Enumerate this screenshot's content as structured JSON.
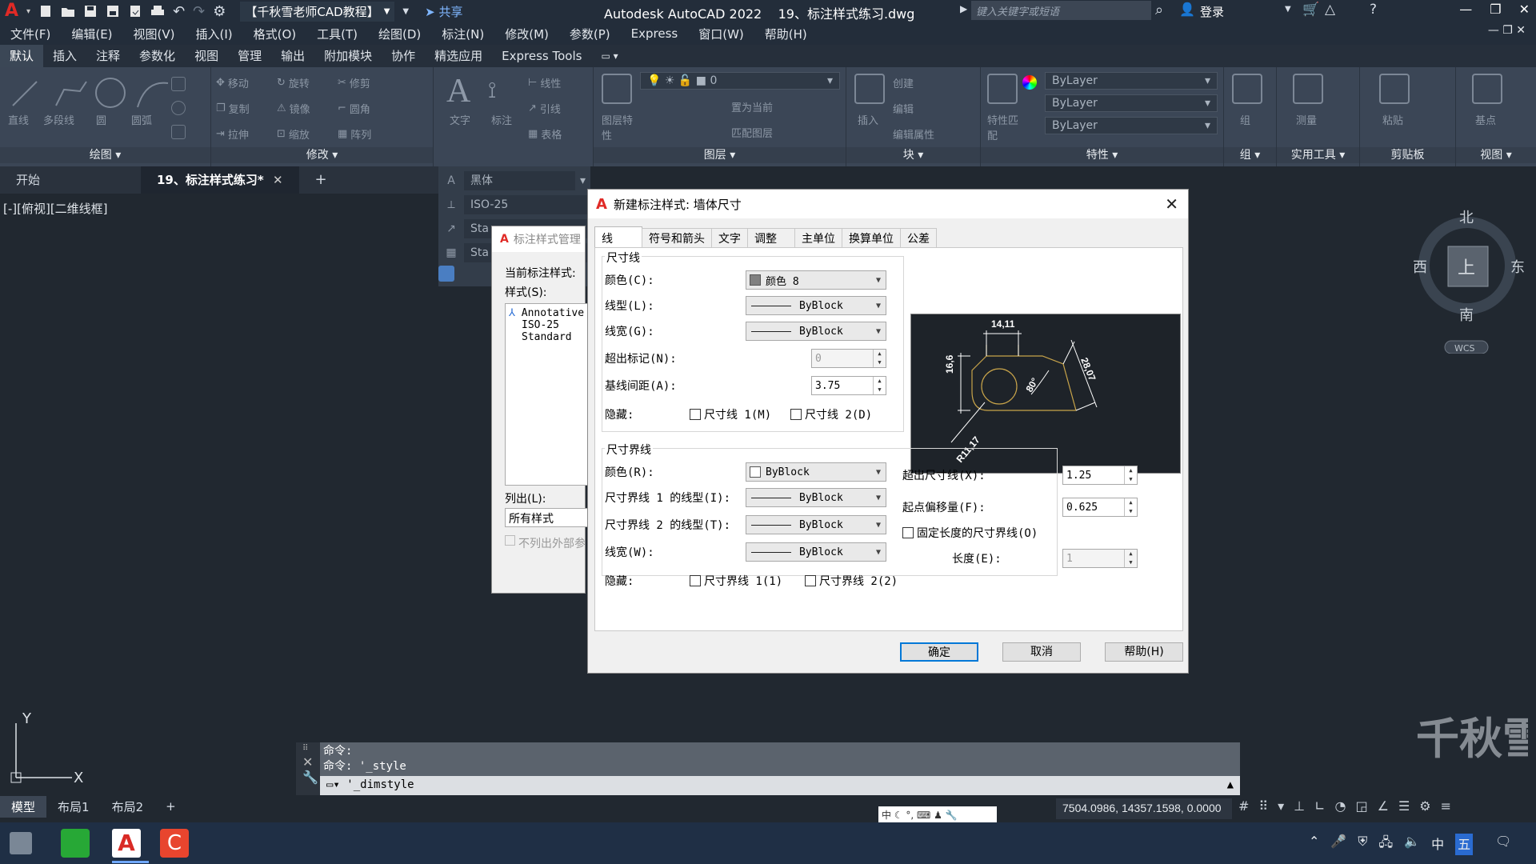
{
  "titlebar": {
    "workspace": "【千秋雪老师CAD教程】",
    "share": "共享",
    "app_title": "Autodesk AutoCAD 2022",
    "doc_title": "19、标注样式练习.dwg",
    "search_placeholder": "键入关键字或短语",
    "login": "登录"
  },
  "menubar": [
    "文件(F)",
    "编辑(E)",
    "视图(V)",
    "插入(I)",
    "格式(O)",
    "工具(T)",
    "绘图(D)",
    "标注(N)",
    "修改(M)",
    "参数(P)",
    "Express",
    "窗口(W)",
    "帮助(H)"
  ],
  "ribbon_tabs": [
    "默认",
    "插入",
    "注释",
    "参数化",
    "视图",
    "管理",
    "输出",
    "附加模块",
    "协作",
    "精选应用",
    "Express Tools"
  ],
  "ribbon": {
    "draw": {
      "label": "绘图",
      "btns": [
        "直线",
        "多段线",
        "圆",
        "圆弧"
      ]
    },
    "modify": {
      "label": "修改",
      "btns": [
        "移动",
        "旋转",
        "修剪",
        "复制",
        "镜像",
        "圆角",
        "拉伸",
        "缩放",
        "阵列"
      ]
    },
    "annotation": {
      "btns": [
        "文字",
        "标注",
        "线性",
        "引线",
        "表格"
      ]
    },
    "layers": {
      "label": "图层",
      "props": "图层特性",
      "layer_value": "0",
      "set_current": "置为当前",
      "match_layer": "匹配图层"
    },
    "block": {
      "label": "块",
      "insert": "插入",
      "create": "创建",
      "edit": "编辑",
      "edit_attr": "编辑属性"
    },
    "properties": {
      "label": "特性",
      "match": "特性匹配",
      "color": "ByLayer",
      "linetype": "ByLayer",
      "lineweight": "ByLayer"
    },
    "group": {
      "label": "组",
      "btn": "组"
    },
    "utilities": {
      "label": "实用工具",
      "btn": "测量"
    },
    "clipboard": {
      "label": "剪贴板",
      "btn": "粘贴"
    },
    "view": {
      "label": "视图",
      "btn": "基点"
    }
  },
  "doc_tabs": [
    "开始",
    "19、标注样式练习*"
  ],
  "viewport_label": "[-][俯视][二维线框]",
  "palette": {
    "font": "黑体",
    "dimstyle": "ISO-25",
    "r3": "Sta",
    "r4": "Sta"
  },
  "bg_dialog": {
    "title": "标注样式管理",
    "current_label": "当前标注样式:",
    "styles_label": "样式(S):",
    "styles": [
      "Annotative",
      "ISO-25",
      "Standard"
    ],
    "list_label": "列出(L):",
    "list_value": "所有样式",
    "checkbox": "不列出外部参"
  },
  "dialog": {
    "title": "新建标注样式: 墙体尺寸",
    "tabs": [
      "线",
      "符号和箭头",
      "文字",
      "调整",
      "主单位",
      "换算单位",
      "公差"
    ],
    "dimlines": {
      "group": "尺寸线",
      "color_label": "颜色(C):",
      "color_value": "颜色 8",
      "color_hex": "#808080",
      "linetype_label": "线型(L):",
      "linetype_value": "ByBlock",
      "lineweight_label": "线宽(G):",
      "lineweight_value": "ByBlock",
      "extend_label": "超出标记(N):",
      "extend_value": "0",
      "baseline_label": "基线间距(A):",
      "baseline_value": "3.75",
      "suppress_label": "隐藏:",
      "suppress1": "尺寸线 1(M)",
      "suppress2": "尺寸线 2(D)"
    },
    "extlines": {
      "group": "尺寸界线",
      "color_label": "颜色(R):",
      "color_value": "ByBlock",
      "lt1_label": "尺寸界线 1 的线型(I):",
      "lt1_value": "ByBlock",
      "lt2_label": "尺寸界线 2 的线型(T):",
      "lt2_value": "ByBlock",
      "lw_label": "线宽(W):",
      "lw_value": "ByBlock",
      "suppress_label": "隐藏:",
      "suppress1": "尺寸界线 1(1)",
      "suppress2": "尺寸界线 2(2)",
      "beyond_label": "超出尺寸线(X):",
      "beyond_value": "1.25",
      "offset_label": "起点偏移量(F):",
      "offset_value": "0.625",
      "fixed_label": "固定长度的尺寸界线(O)",
      "length_label": "长度(E):",
      "length_value": "1"
    },
    "preview": {
      "dim_top": "14,11",
      "dim_left": "16,6",
      "dim_diag": "28,07",
      "angle": "80°",
      "radius": "R11,17"
    },
    "buttons": {
      "ok": "确定",
      "cancel": "取消",
      "help": "帮助(H)"
    }
  },
  "navcube": {
    "north": "北",
    "south": "南",
    "east": "东",
    "west": "西",
    "top": "上",
    "wcs": "WCS"
  },
  "axes": {
    "x": "X",
    "y": "Y"
  },
  "cmdline": {
    "history": [
      "命令:",
      "命令: '_style"
    ],
    "input": "'_dimstyle"
  },
  "layout_tabs": [
    "模型",
    "布局1",
    "布局2"
  ],
  "status": {
    "coords": "7504.0986, 14357.1598, 0.0000",
    "ime": "中"
  },
  "taskbar": {
    "ime": "中",
    "ime2": "五"
  },
  "watermark": "千秋雪"
}
